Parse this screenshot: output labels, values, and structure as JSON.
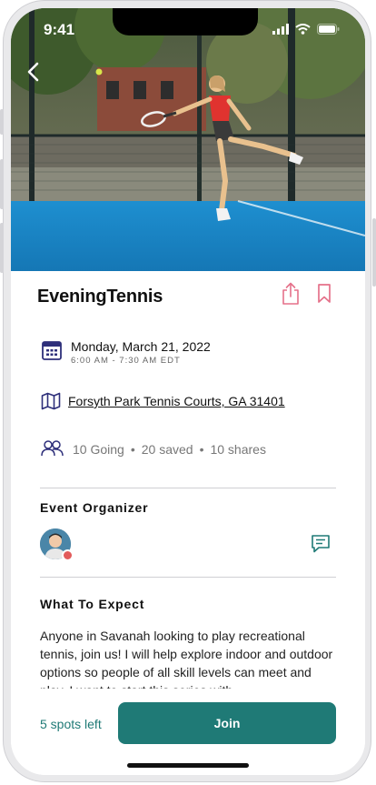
{
  "status_bar": {
    "time": "9:41"
  },
  "event": {
    "title": "EveningTennis",
    "date": "Monday, March 21, 2022",
    "time_range": "6:00 AM - 7:30 AM  EDT",
    "location": "Forsyth Park Tennis Courts, GA 31401",
    "stats": {
      "going": "10 Going",
      "saved": "20 saved",
      "shares": "10 shares",
      "separator": "•"
    }
  },
  "organizer": {
    "section_title": "Event Organizer"
  },
  "expect": {
    "section_title": "What To Expect",
    "description": "Anyone in Savanah looking to play recreational tennis, join us! I will help explore indoor and outdoor options so people of all skill levels can meet and play. I want to start this series with"
  },
  "footer": {
    "spots_left": "5 spots left",
    "join_label": "Join"
  },
  "colors": {
    "accent": "#1f7a76",
    "icon_purple": "#2e2f7a",
    "icon_pink": "#e5718a",
    "court_blue": "#1a88c9"
  },
  "icons": [
    "back-icon",
    "share-icon",
    "bookmark-icon",
    "calendar-icon",
    "map-icon",
    "people-icon",
    "chat-icon"
  ]
}
